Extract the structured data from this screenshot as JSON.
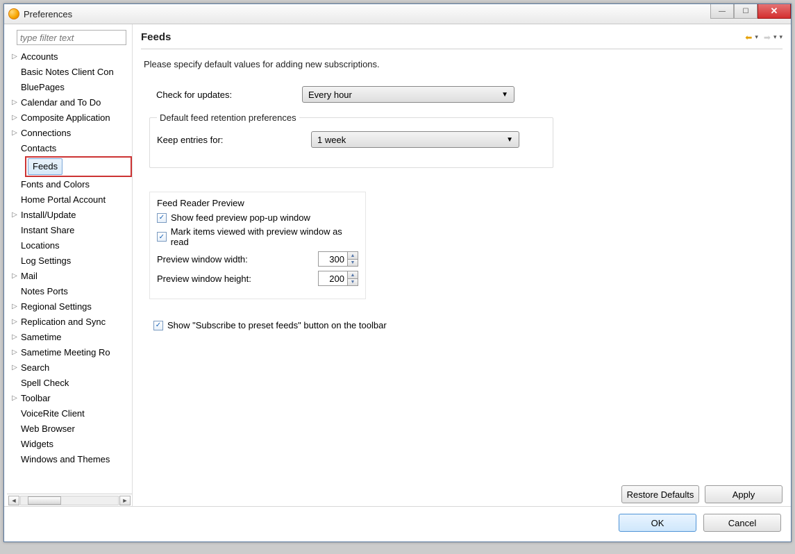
{
  "window": {
    "title": "Preferences"
  },
  "sidebar": {
    "filter_placeholder": "type filter text",
    "items": [
      {
        "label": "Accounts",
        "expandable": true
      },
      {
        "label": "Basic Notes Client Con",
        "expandable": false
      },
      {
        "label": "BluePages",
        "expandable": false
      },
      {
        "label": "Calendar and To Do",
        "expandable": true
      },
      {
        "label": "Composite Application",
        "expandable": true
      },
      {
        "label": "Connections",
        "expandable": true
      },
      {
        "label": "Contacts",
        "expandable": false
      },
      {
        "label": "Feeds",
        "expandable": false,
        "selected": true
      },
      {
        "label": "Fonts and Colors",
        "expandable": false
      },
      {
        "label": "Home Portal Account",
        "expandable": false
      },
      {
        "label": "Install/Update",
        "expandable": true
      },
      {
        "label": "Instant Share",
        "expandable": false
      },
      {
        "label": "Locations",
        "expandable": false
      },
      {
        "label": "Log Settings",
        "expandable": false
      },
      {
        "label": "Mail",
        "expandable": true
      },
      {
        "label": "Notes Ports",
        "expandable": false
      },
      {
        "label": "Regional Settings",
        "expandable": true
      },
      {
        "label": "Replication and Sync",
        "expandable": true
      },
      {
        "label": "Sametime",
        "expandable": true
      },
      {
        "label": "Sametime Meeting Ro",
        "expandable": true
      },
      {
        "label": "Search",
        "expandable": true
      },
      {
        "label": "Spell Check",
        "expandable": false
      },
      {
        "label": "Toolbar",
        "expandable": true
      },
      {
        "label": "VoiceRite Client",
        "expandable": false
      },
      {
        "label": "Web Browser",
        "expandable": false
      },
      {
        "label": "Widgets",
        "expandable": false
      },
      {
        "label": "Windows and Themes",
        "expandable": false
      }
    ]
  },
  "page": {
    "heading": "Feeds",
    "description": "Please specify default values for adding new subscriptions.",
    "check_updates_label": "Check for updates:",
    "check_updates_value": "Every hour",
    "retention_legend": "Default feed retention preferences",
    "keep_entries_label": "Keep entries for:",
    "keep_entries_value": "1 week",
    "preview": {
      "legend": "Feed Reader Preview",
      "show_popup": "Show feed preview pop-up window",
      "show_popup_checked": true,
      "mark_read": "Mark items viewed with preview window as read",
      "mark_read_checked": true,
      "width_label": "Preview window width:",
      "width_value": "300",
      "height_label": "Preview window height:",
      "height_value": "200"
    },
    "show_subscribe_toolbar": "Show \"Subscribe to preset feeds\" button on the toolbar",
    "show_subscribe_toolbar_checked": true,
    "restore_defaults": "Restore Defaults",
    "apply": "Apply"
  },
  "footer": {
    "ok": "OK",
    "cancel": "Cancel"
  }
}
